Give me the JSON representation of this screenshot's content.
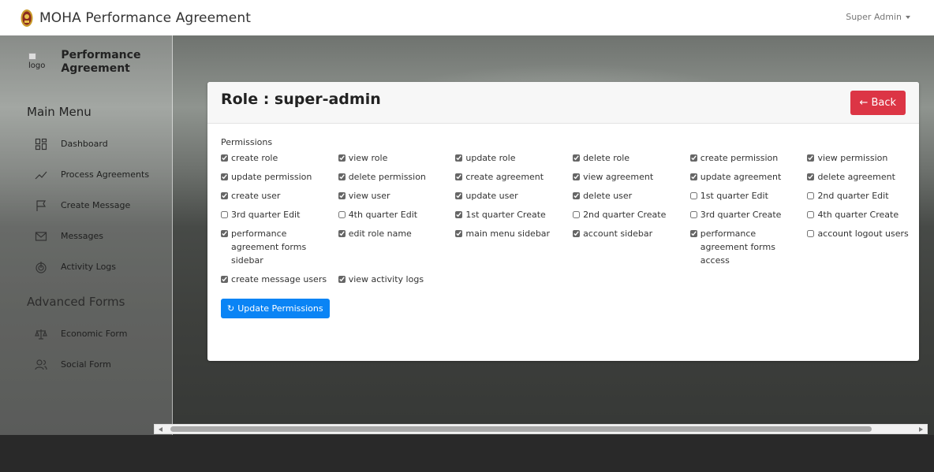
{
  "header": {
    "title": "MOHA Performance Agreement",
    "user_menu": "Super Admin"
  },
  "sidebar": {
    "logo_alt": "logo",
    "title": "Performance Agreement",
    "main_menu_title": "Main Menu",
    "main_items": [
      {
        "label": "Dashboard",
        "icon": "dashboard-icon"
      },
      {
        "label": "Process Agreements",
        "icon": "trending-icon"
      },
      {
        "label": "Create Message",
        "icon": "flag-icon"
      },
      {
        "label": "Messages",
        "icon": "mail-icon"
      },
      {
        "label": "Activity Logs",
        "icon": "activity-icon"
      }
    ],
    "advanced_title": "Advanced Forms",
    "advanced_items": [
      {
        "label": "Economic Form",
        "icon": "scale-icon"
      },
      {
        "label": "Social Form",
        "icon": "users-icon"
      }
    ]
  },
  "card": {
    "title": "Role : super-admin",
    "back_label": "Back",
    "permissions_label": "Permissions",
    "update_label": "Update Permissions"
  },
  "permissions": [
    {
      "label": "create role",
      "checked": true
    },
    {
      "label": "view role",
      "checked": true
    },
    {
      "label": "update role",
      "checked": true
    },
    {
      "label": "delete role",
      "checked": true
    },
    {
      "label": "create permission",
      "checked": true
    },
    {
      "label": "view permission",
      "checked": true
    },
    {
      "label": "update permission",
      "checked": true
    },
    {
      "label": "delete permission",
      "checked": true
    },
    {
      "label": "create agreement",
      "checked": true
    },
    {
      "label": "view agreement",
      "checked": true
    },
    {
      "label": "update agreement",
      "checked": true
    },
    {
      "label": "delete agreement",
      "checked": true
    },
    {
      "label": "create user",
      "checked": true
    },
    {
      "label": "view user",
      "checked": true
    },
    {
      "label": "update user",
      "checked": true
    },
    {
      "label": "delete user",
      "checked": true
    },
    {
      "label": "1st quarter Edit",
      "checked": false
    },
    {
      "label": "2nd quarter Edit",
      "checked": false
    },
    {
      "label": "3rd quarter Edit",
      "checked": false
    },
    {
      "label": "4th quarter Edit",
      "checked": false
    },
    {
      "label": "1st quarter Create",
      "checked": true
    },
    {
      "label": "2nd quarter Create",
      "checked": false
    },
    {
      "label": "3rd quarter Create",
      "checked": false
    },
    {
      "label": "4th quarter Create",
      "checked": false
    },
    {
      "label": "performance agreement forms sidebar",
      "checked": true
    },
    {
      "label": "edit role name",
      "checked": true
    },
    {
      "label": "main menu sidebar",
      "checked": true
    },
    {
      "label": "account sidebar",
      "checked": true
    },
    {
      "label": "performance agreement forms access",
      "checked": true
    },
    {
      "label": "account logout users",
      "checked": false
    },
    {
      "label": "create message users",
      "checked": true
    },
    {
      "label": "view activity logs",
      "checked": true
    }
  ]
}
